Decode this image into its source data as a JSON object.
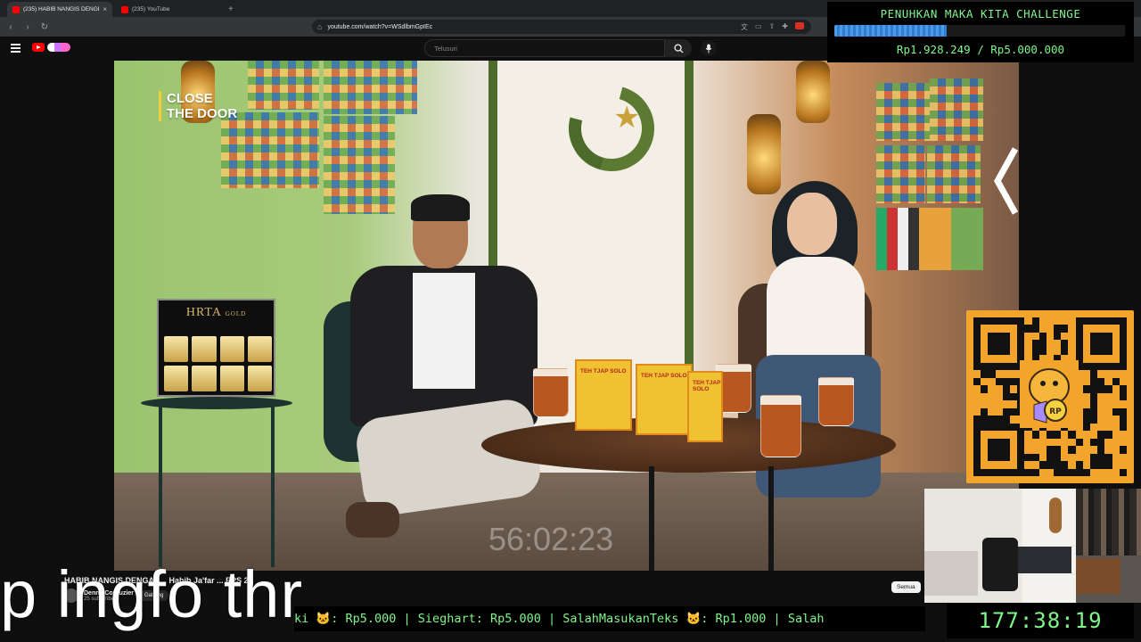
{
  "browser": {
    "tabs": [
      {
        "title": "(235) HABIB NANGIS DENGE...",
        "active": true
      },
      {
        "title": "(235) YouTube",
        "active": false
      }
    ],
    "new_tab_glyph": "+",
    "url": "youtube.com/watch?v=WSdlbmGpIEc",
    "icons": [
      "back-icon",
      "forward-icon",
      "reload-icon",
      "bookmark-icon",
      "translate-icon",
      "extension-icon"
    ]
  },
  "youtube": {
    "search_placeholder": "Telusuri",
    "video_overlay_title": "CLOSE\nTHE DOOR",
    "video_timestamp": "56:02:23",
    "video_title": "HABIB NANGIS DENGAN... Habib Ja'far ... EPS 21",
    "channel_name": "Denny Corbuzier",
    "channel_subs": "25 subscriber",
    "join_label": "Gabung",
    "filter_chip": "Semua",
    "brand_box": "HRTA",
    "brand_box_sub": "GOLD",
    "tea_box": "TEH TJAP SOLO"
  },
  "overlay": {
    "challenge_title": "PENUHKAN MAKA KITA CHALLENGE",
    "progress_fraction": 0.3856,
    "progress_amount": "Rp1.928.249 / Rp5.000.000",
    "ticker_text_1": "ki ",
    "ticker_text_2": ": Rp5.000 | Sieghart: Rp5.000 | SalahMasukanTeks ",
    "ticker_text_3": ": Rp1.000 | Salah",
    "ticker_emoji": "🐱",
    "clock": "177:38:19",
    "subtitle": "p ingfo thr",
    "qr_badge": "RP"
  },
  "colors": {
    "accent_green": "#7ff58a",
    "progress_blue": "#2f7cd0",
    "youtube_red": "#ff0000",
    "qr_orange": "#f3a52b"
  }
}
